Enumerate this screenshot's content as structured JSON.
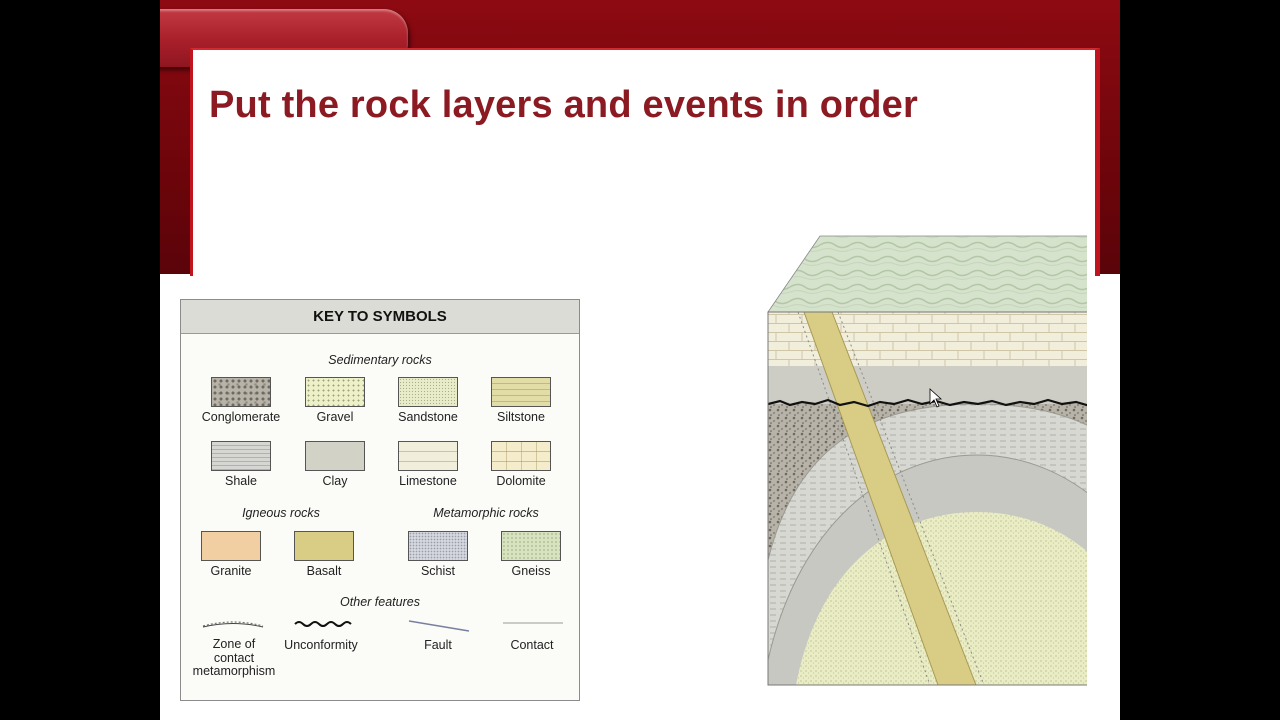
{
  "slide": {
    "title": "Put the rock layers and events in order"
  },
  "key": {
    "header": "KEY TO SYMBOLS",
    "sections": {
      "sedimentary": "Sedimentary rocks",
      "igneous": "Igneous rocks",
      "metamorphic": "Metamorphic rocks",
      "other": "Other features"
    },
    "sedimentary": [
      {
        "label": "Conglomerate"
      },
      {
        "label": "Gravel"
      },
      {
        "label": "Sandstone"
      },
      {
        "label": "Siltstone"
      },
      {
        "label": "Shale"
      },
      {
        "label": "Clay"
      },
      {
        "label": "Limestone"
      },
      {
        "label": "Dolomite"
      }
    ],
    "igneous": [
      {
        "label": "Granite"
      },
      {
        "label": "Basalt"
      }
    ],
    "metamorphic": [
      {
        "label": "Schist"
      },
      {
        "label": "Gneiss"
      }
    ],
    "other": [
      {
        "label_lines": [
          "Zone of",
          "contact",
          "metamorphism"
        ]
      },
      {
        "label": "Unconformity"
      },
      {
        "label": "Fault"
      },
      {
        "label": "Contact"
      }
    ]
  },
  "colors": {
    "frame_red": "#8e0a12",
    "title_red": "#8c1a22",
    "granite": "#f2cfa3",
    "basalt": "#d9cc85",
    "limestone": "#f2eedc",
    "sandstone": "#e9ecc8",
    "schist": "#d4d7de",
    "gneiss": "#d7e2be",
    "shale": "#d6d6d2",
    "clay": "#d2d2c6",
    "conglomerate": "#b8b3a8",
    "siltstone": "#e2dca6",
    "dolomite": "#f4eccb",
    "gravel": "#eef0c8"
  }
}
